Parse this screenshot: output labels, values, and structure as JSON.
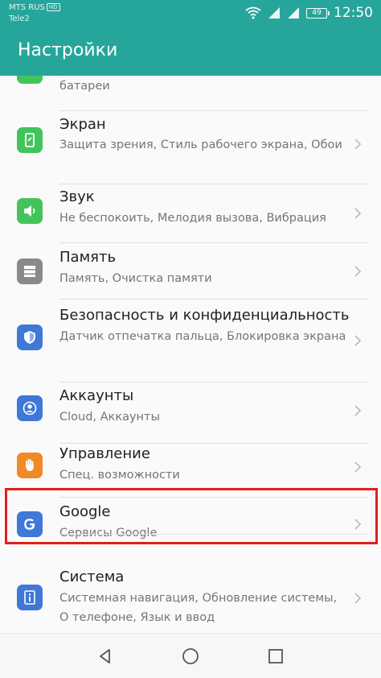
{
  "status_bar": {
    "carrier_primary": "MTS RUS",
    "carrier_badge": "HD",
    "carrier_secondary": "Tele2",
    "battery_level": "49",
    "time": "12:50"
  },
  "app_bar": {
    "title": "Настройки"
  },
  "settings_items": [
    {
      "id": "battery",
      "title": "",
      "subtitle": "батареи",
      "icon": "battery-icon",
      "icon_color": "#43c45a"
    },
    {
      "id": "display",
      "title": "Экран",
      "subtitle": "Защита зрения, Стиль рабочего экрана, Обои",
      "icon": "display-icon",
      "icon_color": "#43c45a"
    },
    {
      "id": "sound",
      "title": "Звук",
      "subtitle": "Не беспокоить, Мелодия вызова, Вибрация",
      "icon": "speaker-icon",
      "icon_color": "#43c45a"
    },
    {
      "id": "storage",
      "title": "Память",
      "subtitle": "Память, Очистка памяти",
      "icon": "storage-icon",
      "icon_color": "#8a8a8a"
    },
    {
      "id": "security",
      "title": "Безопасность и конфиденциальность",
      "subtitle": "Датчик отпечатка пальца, Блокировка экрана",
      "icon": "shield-icon",
      "icon_color": "#3f78d6"
    },
    {
      "id": "accounts",
      "title": "Аккаунты",
      "subtitle": "Cloud, Аккаунты",
      "icon": "account-icon",
      "icon_color": "#3f78d6"
    },
    {
      "id": "accessibility",
      "title": "Управление",
      "subtitle": "Спец. возможности",
      "icon": "hand-icon",
      "icon_color": "#f08a24"
    },
    {
      "id": "google",
      "title": "Google",
      "subtitle": "Сервисы Google",
      "icon": "google-icon",
      "icon_color": "#3f78d6"
    },
    {
      "id": "system",
      "title": "Система",
      "subtitle": "Системная навигация, Обновление системы, О телефоне, Язык и ввод",
      "icon": "info-icon",
      "icon_color": "#3f78d6"
    }
  ],
  "nav_bar": {
    "back": "back-icon",
    "home": "home-icon",
    "recents": "recents-icon"
  }
}
